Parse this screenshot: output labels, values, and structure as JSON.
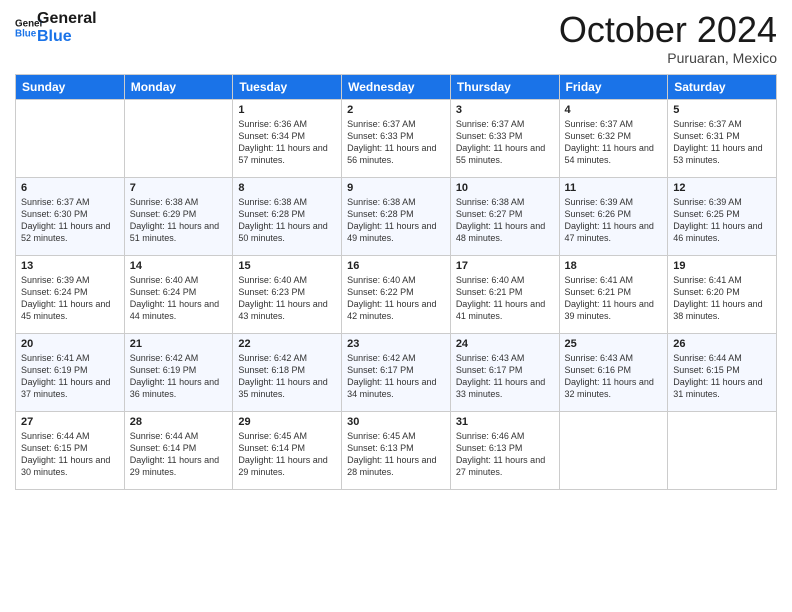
{
  "logo": {
    "line1": "General",
    "line2": "Blue"
  },
  "header": {
    "month": "October 2024",
    "location": "Puruaran, Mexico"
  },
  "weekdays": [
    "Sunday",
    "Monday",
    "Tuesday",
    "Wednesday",
    "Thursday",
    "Friday",
    "Saturday"
  ],
  "weeks": [
    [
      {
        "day": "",
        "sunrise": "",
        "sunset": "",
        "daylight": ""
      },
      {
        "day": "",
        "sunrise": "",
        "sunset": "",
        "daylight": ""
      },
      {
        "day": "1",
        "sunrise": "Sunrise: 6:36 AM",
        "sunset": "Sunset: 6:34 PM",
        "daylight": "Daylight: 11 hours and 57 minutes."
      },
      {
        "day": "2",
        "sunrise": "Sunrise: 6:37 AM",
        "sunset": "Sunset: 6:33 PM",
        "daylight": "Daylight: 11 hours and 56 minutes."
      },
      {
        "day": "3",
        "sunrise": "Sunrise: 6:37 AM",
        "sunset": "Sunset: 6:33 PM",
        "daylight": "Daylight: 11 hours and 55 minutes."
      },
      {
        "day": "4",
        "sunrise": "Sunrise: 6:37 AM",
        "sunset": "Sunset: 6:32 PM",
        "daylight": "Daylight: 11 hours and 54 minutes."
      },
      {
        "day": "5",
        "sunrise": "Sunrise: 6:37 AM",
        "sunset": "Sunset: 6:31 PM",
        "daylight": "Daylight: 11 hours and 53 minutes."
      }
    ],
    [
      {
        "day": "6",
        "sunrise": "Sunrise: 6:37 AM",
        "sunset": "Sunset: 6:30 PM",
        "daylight": "Daylight: 11 hours and 52 minutes."
      },
      {
        "day": "7",
        "sunrise": "Sunrise: 6:38 AM",
        "sunset": "Sunset: 6:29 PM",
        "daylight": "Daylight: 11 hours and 51 minutes."
      },
      {
        "day": "8",
        "sunrise": "Sunrise: 6:38 AM",
        "sunset": "Sunset: 6:28 PM",
        "daylight": "Daylight: 11 hours and 50 minutes."
      },
      {
        "day": "9",
        "sunrise": "Sunrise: 6:38 AM",
        "sunset": "Sunset: 6:28 PM",
        "daylight": "Daylight: 11 hours and 49 minutes."
      },
      {
        "day": "10",
        "sunrise": "Sunrise: 6:38 AM",
        "sunset": "Sunset: 6:27 PM",
        "daylight": "Daylight: 11 hours and 48 minutes."
      },
      {
        "day": "11",
        "sunrise": "Sunrise: 6:39 AM",
        "sunset": "Sunset: 6:26 PM",
        "daylight": "Daylight: 11 hours and 47 minutes."
      },
      {
        "day": "12",
        "sunrise": "Sunrise: 6:39 AM",
        "sunset": "Sunset: 6:25 PM",
        "daylight": "Daylight: 11 hours and 46 minutes."
      }
    ],
    [
      {
        "day": "13",
        "sunrise": "Sunrise: 6:39 AM",
        "sunset": "Sunset: 6:24 PM",
        "daylight": "Daylight: 11 hours and 45 minutes."
      },
      {
        "day": "14",
        "sunrise": "Sunrise: 6:40 AM",
        "sunset": "Sunset: 6:24 PM",
        "daylight": "Daylight: 11 hours and 44 minutes."
      },
      {
        "day": "15",
        "sunrise": "Sunrise: 6:40 AM",
        "sunset": "Sunset: 6:23 PM",
        "daylight": "Daylight: 11 hours and 43 minutes."
      },
      {
        "day": "16",
        "sunrise": "Sunrise: 6:40 AM",
        "sunset": "Sunset: 6:22 PM",
        "daylight": "Daylight: 11 hours and 42 minutes."
      },
      {
        "day": "17",
        "sunrise": "Sunrise: 6:40 AM",
        "sunset": "Sunset: 6:21 PM",
        "daylight": "Daylight: 11 hours and 41 minutes."
      },
      {
        "day": "18",
        "sunrise": "Sunrise: 6:41 AM",
        "sunset": "Sunset: 6:21 PM",
        "daylight": "Daylight: 11 hours and 39 minutes."
      },
      {
        "day": "19",
        "sunrise": "Sunrise: 6:41 AM",
        "sunset": "Sunset: 6:20 PM",
        "daylight": "Daylight: 11 hours and 38 minutes."
      }
    ],
    [
      {
        "day": "20",
        "sunrise": "Sunrise: 6:41 AM",
        "sunset": "Sunset: 6:19 PM",
        "daylight": "Daylight: 11 hours and 37 minutes."
      },
      {
        "day": "21",
        "sunrise": "Sunrise: 6:42 AM",
        "sunset": "Sunset: 6:19 PM",
        "daylight": "Daylight: 11 hours and 36 minutes."
      },
      {
        "day": "22",
        "sunrise": "Sunrise: 6:42 AM",
        "sunset": "Sunset: 6:18 PM",
        "daylight": "Daylight: 11 hours and 35 minutes."
      },
      {
        "day": "23",
        "sunrise": "Sunrise: 6:42 AM",
        "sunset": "Sunset: 6:17 PM",
        "daylight": "Daylight: 11 hours and 34 minutes."
      },
      {
        "day": "24",
        "sunrise": "Sunrise: 6:43 AM",
        "sunset": "Sunset: 6:17 PM",
        "daylight": "Daylight: 11 hours and 33 minutes."
      },
      {
        "day": "25",
        "sunrise": "Sunrise: 6:43 AM",
        "sunset": "Sunset: 6:16 PM",
        "daylight": "Daylight: 11 hours and 32 minutes."
      },
      {
        "day": "26",
        "sunrise": "Sunrise: 6:44 AM",
        "sunset": "Sunset: 6:15 PM",
        "daylight": "Daylight: 11 hours and 31 minutes."
      }
    ],
    [
      {
        "day": "27",
        "sunrise": "Sunrise: 6:44 AM",
        "sunset": "Sunset: 6:15 PM",
        "daylight": "Daylight: 11 hours and 30 minutes."
      },
      {
        "day": "28",
        "sunrise": "Sunrise: 6:44 AM",
        "sunset": "Sunset: 6:14 PM",
        "daylight": "Daylight: 11 hours and 29 minutes."
      },
      {
        "day": "29",
        "sunrise": "Sunrise: 6:45 AM",
        "sunset": "Sunset: 6:14 PM",
        "daylight": "Daylight: 11 hours and 29 minutes."
      },
      {
        "day": "30",
        "sunrise": "Sunrise: 6:45 AM",
        "sunset": "Sunset: 6:13 PM",
        "daylight": "Daylight: 11 hours and 28 minutes."
      },
      {
        "day": "31",
        "sunrise": "Sunrise: 6:46 AM",
        "sunset": "Sunset: 6:13 PM",
        "daylight": "Daylight: 11 hours and 27 minutes."
      },
      {
        "day": "",
        "sunrise": "",
        "sunset": "",
        "daylight": ""
      },
      {
        "day": "",
        "sunrise": "",
        "sunset": "",
        "daylight": ""
      }
    ]
  ]
}
